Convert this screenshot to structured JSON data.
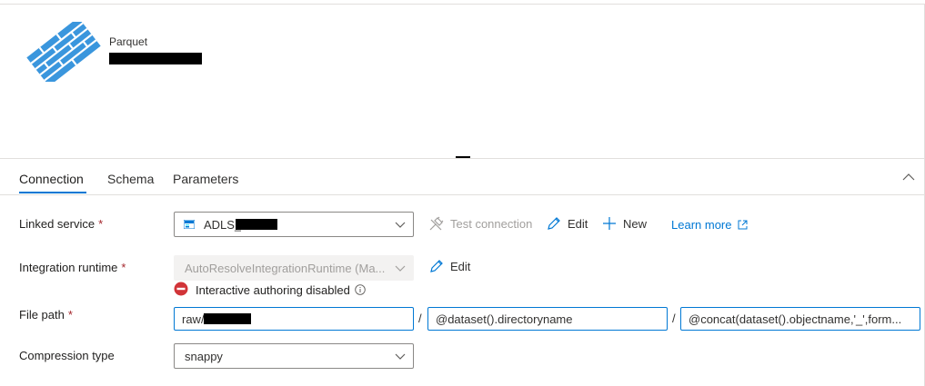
{
  "dataset": {
    "type": "Parquet",
    "icon": "parquet-dataset-icon"
  },
  "tabs": [
    {
      "label": "Connection",
      "active": true
    },
    {
      "label": "Schema",
      "active": false
    },
    {
      "label": "Parameters",
      "active": false
    }
  ],
  "linked_service": {
    "label": "Linked service",
    "required": "*",
    "value": "ADLS_",
    "icon": "storage-icon",
    "test_connection": "Test connection",
    "edit": "Edit",
    "new": "New",
    "learn_more": "Learn more"
  },
  "integration_runtime": {
    "label": "Integration runtime",
    "required": "*",
    "value": "AutoResolveIntegrationRuntime (Ma...",
    "edit": "Edit",
    "warning": "Interactive authoring disabled"
  },
  "file_path": {
    "label": "File path",
    "required": "*",
    "container": "raw/",
    "directory": "@dataset().directoryname",
    "file": "@concat(dataset().objectname,'_',form...",
    "separator": "/"
  },
  "compression": {
    "label": "Compression type",
    "value": "snappy"
  },
  "colors": {
    "accent": "#0078d4",
    "error": "#d13438",
    "required": "#a4262c"
  }
}
